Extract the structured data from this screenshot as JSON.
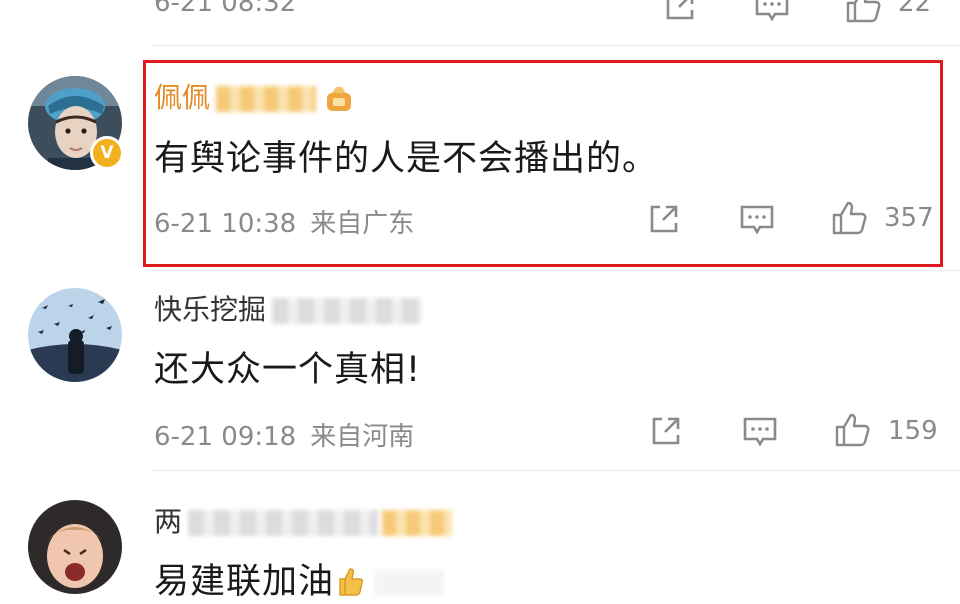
{
  "top_partial": {
    "meta": "6-21 08:32",
    "like_count": "22"
  },
  "comments": [
    {
      "username": "佩佩",
      "username_color": "#e38a24",
      "verified": true,
      "text": "有舆论事件的人是不会播出的。",
      "date": "6-21 10:38",
      "location": "来自广东",
      "like_count": "357",
      "highlighted": true,
      "highlight_color": "#e01a1a"
    },
    {
      "username": "快乐挖掘",
      "text": "还大众一个真相!",
      "date": "6-21 09:18",
      "location": "来自河南",
      "like_count": "159"
    },
    {
      "username": "两",
      "text": "易建联加油"
    }
  ],
  "icons": {
    "share": "share-icon",
    "comment": "comment-icon",
    "like": "thumbs-up-icon",
    "verified": "verified-v-icon",
    "vip": "vip-badge-icon",
    "thumbs_emoji": "thumbs-up-emoji"
  }
}
